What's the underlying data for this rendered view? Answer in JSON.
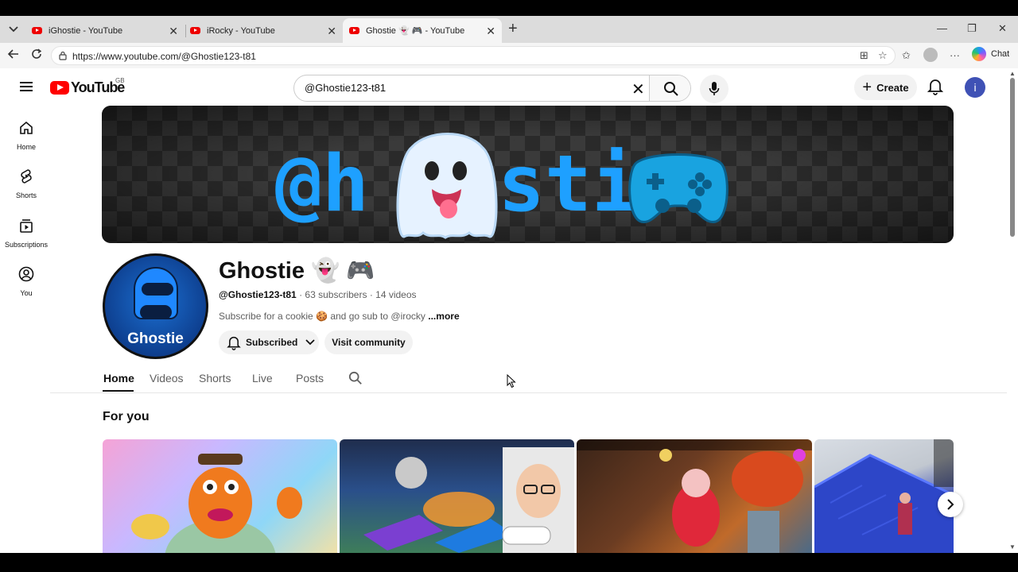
{
  "browser": {
    "tabs": [
      {
        "title": "iGhostie - YouTube"
      },
      {
        "title": "iRocky - YouTube"
      },
      {
        "title": "Ghostie 👻 🎮 - YouTube"
      }
    ],
    "url": "https://www.youtube.com/@Ghostie123-t81",
    "chat_label": "Chat"
  },
  "yt": {
    "logo_text": "YouTube",
    "region": "GB",
    "search_value": "@Ghostie123-t81",
    "create_label": "Create",
    "avatar_letter": "i",
    "sidebar": [
      {
        "label": "Home",
        "icon": "home-icon"
      },
      {
        "label": "Shorts",
        "icon": "shorts-icon"
      },
      {
        "label": "Subscriptions",
        "icon": "subscriptions-icon"
      },
      {
        "label": "You",
        "icon": "you-icon"
      }
    ]
  },
  "channel": {
    "banner_text_left": "@h",
    "banner_text_right": "sti",
    "avatar_text": "Ghostie",
    "title": "Ghostie 👻 🎮",
    "handle": "@Ghostie123-t81",
    "subscribers": "63 subscribers",
    "videos": "14 videos",
    "description": "Subscribe for a cookie 🍪 and go sub to @irocky",
    "more_label": "...more",
    "subscribed_label": "Subscribed",
    "community_label": "Visit community",
    "tabs": [
      "Home",
      "Videos",
      "Shorts",
      "Live",
      "Posts"
    ],
    "section_title": "For you"
  },
  "colors": {
    "brand_red": "#ff0000",
    "banner_blue": "#1ea0ff",
    "avatar_blue": "#3f51b5"
  }
}
